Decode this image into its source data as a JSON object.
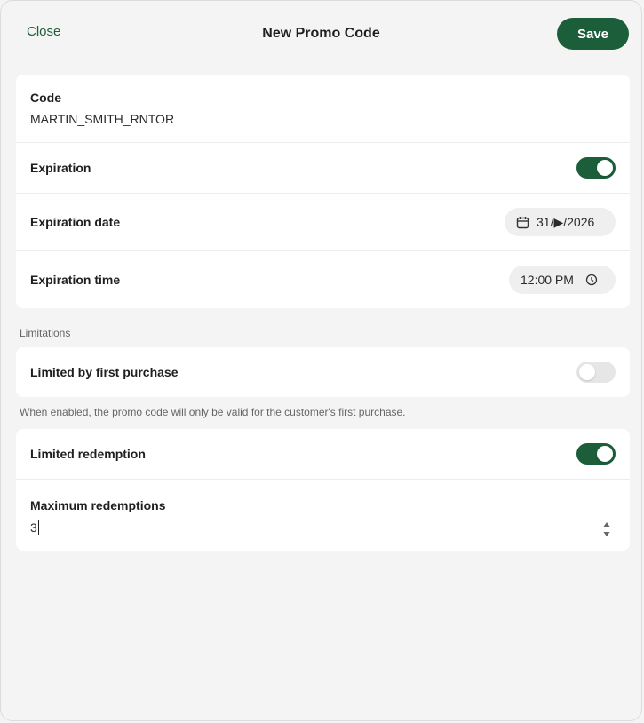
{
  "header": {
    "close_label": "Close",
    "title": "New Promo Code",
    "save_label": "Save"
  },
  "code": {
    "label": "Code",
    "value": "MARTIN_SMITH_RNTOR"
  },
  "expiration": {
    "label": "Expiration",
    "enabled": true
  },
  "expiration_date": {
    "label": "Expiration date",
    "value": "31/▶/2026"
  },
  "expiration_time": {
    "label": "Expiration time",
    "value": "12:00 PM"
  },
  "limitations": {
    "section_label": "Limitations",
    "first_purchase_label": "Limited by first purchase",
    "first_purchase_enabled": false,
    "first_purchase_help": "When enabled, the promo code will only be valid for the customer's first purchase.",
    "redemption_label": "Limited redemption",
    "redemption_enabled": true,
    "max_redemptions_label": "Maximum redemptions",
    "max_redemptions_value": "3"
  },
  "colors": {
    "accent": "#1c5e3a",
    "toggle_off": "#e6e6e6",
    "background": "#f4f4f4"
  },
  "icons": [
    "calendar-icon",
    "clock-icon",
    "stepper-arrows-icon"
  ]
}
